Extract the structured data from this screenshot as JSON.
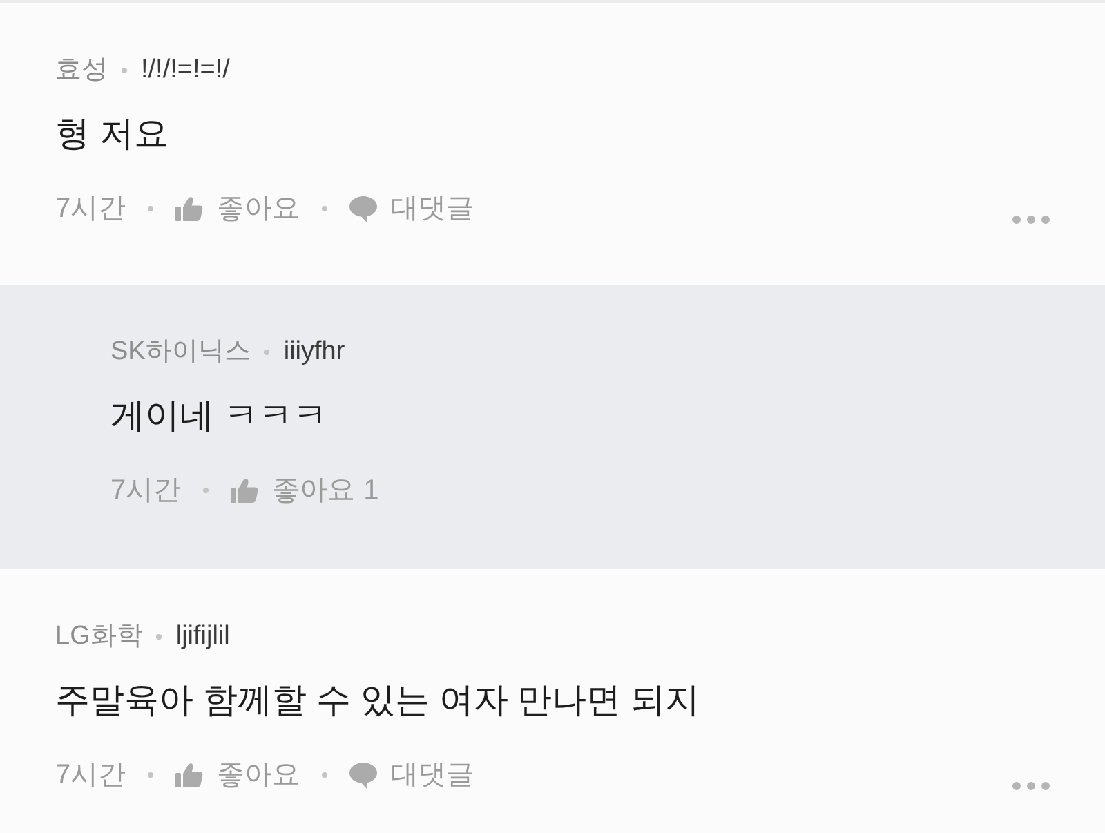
{
  "comments": [
    {
      "kind": "comment",
      "author": "효성",
      "nickname": "!/!/!=!=!/",
      "text": "형 저요",
      "time": "7시간",
      "like_label": "좋아요",
      "reply_label": "대댓글"
    },
    {
      "kind": "reply",
      "author": "SK하이닉스",
      "nickname": "iiiyfhr",
      "text": "게이네 ㅋㅋㅋ",
      "time": "7시간",
      "like_label": "좋아요",
      "like_count": "1"
    },
    {
      "kind": "comment",
      "author": "LG화학",
      "nickname": "ljifijlil",
      "text": "주말육아 함께할 수 있는 여자 만나면 되지",
      "time": "7시간",
      "like_label": "좋아요",
      "reply_label": "대댓글"
    }
  ]
}
